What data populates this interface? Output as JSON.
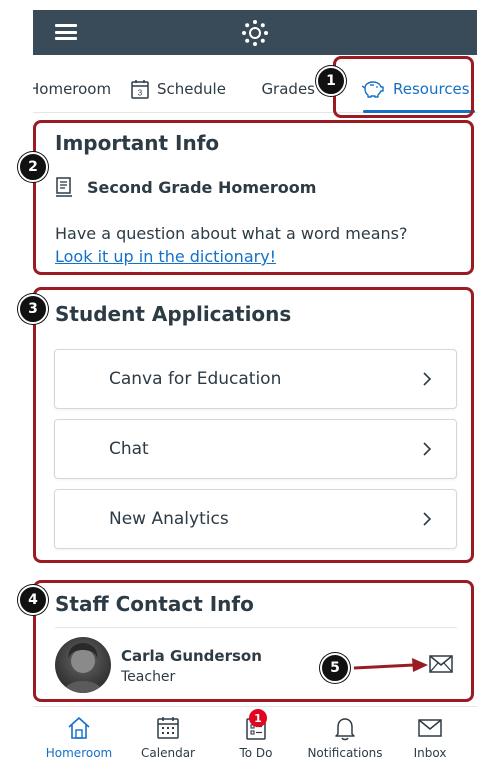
{
  "tabs": [
    {
      "label": "Homeroom"
    },
    {
      "label": "Schedule"
    },
    {
      "label": "Grades"
    },
    {
      "label": "Resources"
    }
  ],
  "important_info": {
    "title": "Important Info",
    "course": "Second Grade Homeroom",
    "text": "Have a question about what a word means?",
    "link": "Look it up in the dictionary!"
  },
  "student_apps": {
    "title": "Student Applications",
    "items": [
      {
        "label": "Canva for Education"
      },
      {
        "label": "Chat"
      },
      {
        "label": "New Analytics"
      }
    ]
  },
  "staff": {
    "title": "Staff Contact Info",
    "name": "Carla Gunderson",
    "role": "Teacher"
  },
  "bottom_nav": [
    {
      "label": "Homeroom"
    },
    {
      "label": "Calendar"
    },
    {
      "label": "To Do",
      "badge": "1"
    },
    {
      "label": "Notifications"
    },
    {
      "label": "Inbox"
    }
  ],
  "callouts": [
    "1",
    "2",
    "3",
    "4",
    "5"
  ],
  "colors": {
    "header": "#394b58",
    "accent": "#1570c8",
    "callout_border": "#9b1b23",
    "badge": "#e0061f"
  }
}
